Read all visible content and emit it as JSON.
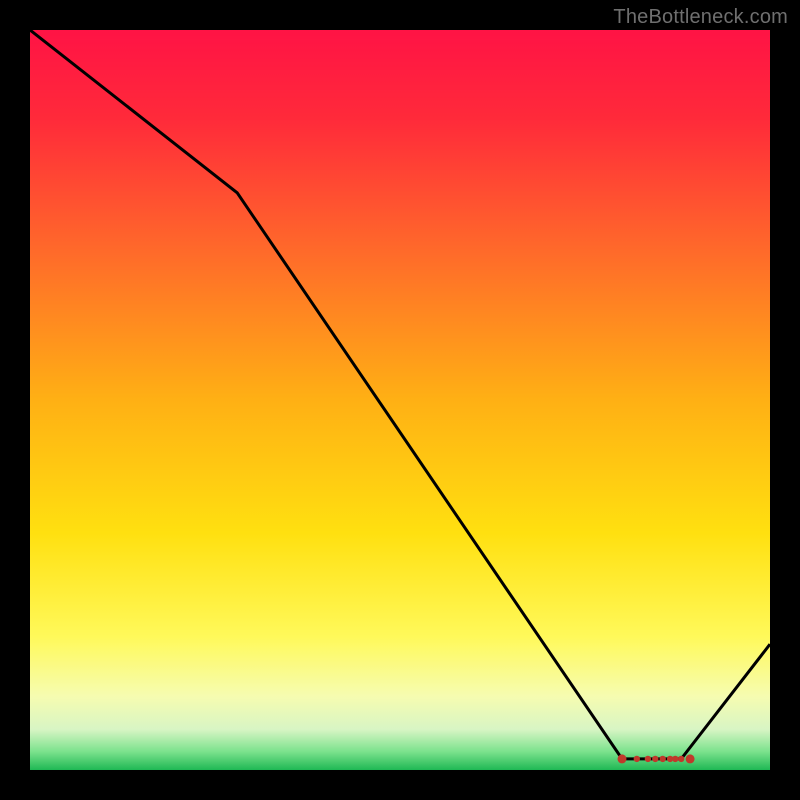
{
  "watermark": "TheBottleneck.com",
  "chart_data": {
    "type": "line",
    "title": "",
    "xlabel": "",
    "ylabel": "",
    "xlim": [
      0,
      100
    ],
    "ylim": [
      0,
      100
    ],
    "x": [
      0,
      28,
      80,
      88,
      100
    ],
    "values": [
      100,
      78,
      1.5,
      1.5,
      17
    ],
    "markers": {
      "x": [
        80,
        82,
        83.5,
        84.5,
        85.5,
        86.5,
        87.2,
        88,
        89.2
      ],
      "y": [
        1.5,
        1.5,
        1.5,
        1.5,
        1.5,
        1.5,
        1.5,
        1.5,
        1.5
      ],
      "color": "#c0392b"
    },
    "gradient_stops": [
      {
        "offset": 0.0,
        "color": "#ff1345"
      },
      {
        "offset": 0.12,
        "color": "#ff2a3a"
      },
      {
        "offset": 0.3,
        "color": "#ff6a2a"
      },
      {
        "offset": 0.5,
        "color": "#ffb014"
      },
      {
        "offset": 0.68,
        "color": "#ffe010"
      },
      {
        "offset": 0.82,
        "color": "#fff95a"
      },
      {
        "offset": 0.9,
        "color": "#f6fcb0"
      },
      {
        "offset": 0.945,
        "color": "#d8f5c4"
      },
      {
        "offset": 0.975,
        "color": "#7ce28d"
      },
      {
        "offset": 1.0,
        "color": "#1fb854"
      }
    ],
    "line_color": "#000000",
    "line_width": 3
  }
}
